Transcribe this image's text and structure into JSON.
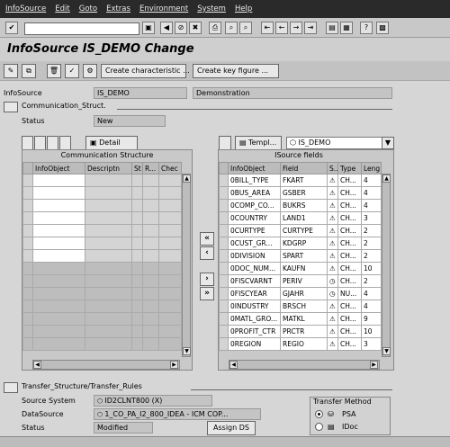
{
  "menu": [
    "InfoSource",
    "Edit",
    "Goto",
    "Extras",
    "Environment",
    "System",
    "Help"
  ],
  "title": "InfoSource IS_DEMO Change",
  "app_toolbar": {
    "create_characteristic": "Create characteristic ...",
    "create_keyfigure": "Create key figure ..."
  },
  "infosource": {
    "label": "InfoSource",
    "value": "IS_DEMO",
    "description": "Demonstration"
  },
  "comm_struct": {
    "section_title": "Communication_Struct.",
    "status_label": "Status",
    "status_value": "New",
    "detail_button": "Detail",
    "panel_title": "Communication Structure",
    "columns": [
      "InfoObject",
      "Descriptn",
      "St",
      "R...",
      "Chec"
    ]
  },
  "isource": {
    "template_button": "Templ...",
    "dropdown_value": "IS_DEMO",
    "panel_title": "ISource fields",
    "columns": [
      "InfoObject",
      "Field",
      "S...",
      "Type",
      "Leng"
    ],
    "rows": [
      [
        "0BILL_TYPE",
        "FKART",
        "CH...",
        "4"
      ],
      [
        "0BUS_AREA",
        "GSBER",
        "CH...",
        "4"
      ],
      [
        "0COMP_CO...",
        "BUKRS",
        "CH...",
        "4"
      ],
      [
        "0COUNTRY",
        "LAND1",
        "CH...",
        "3"
      ],
      [
        "0CURTYPE",
        "CURTYPE",
        "CH...",
        "2"
      ],
      [
        "0CUST_GR...",
        "KDGRP",
        "CH...",
        "2"
      ],
      [
        "0DIVISION",
        "SPART",
        "CH...",
        "2"
      ],
      [
        "0DOC_NUM...",
        "KAUFN",
        "CH...",
        "10"
      ],
      [
        "0FISCVARNT",
        "PERIV",
        "CH...",
        "2"
      ],
      [
        "0FISCYEAR",
        "GJAHR",
        "NU...",
        "4"
      ],
      [
        "0INDUSTRY",
        "BRSCH",
        "CH...",
        "4"
      ],
      [
        "0MATL_GRO...",
        "MATKL",
        "CH...",
        "9"
      ],
      [
        "0PROFIT_CTR",
        "PRCTR",
        "CH...",
        "10"
      ],
      [
        "0REGION",
        "REGIO",
        "CH...",
        "3"
      ]
    ]
  },
  "transfer": {
    "section_title": "Transfer_Structure/Transfer_Rules",
    "source_system_label": "Source System",
    "source_system_value": "ID2CLNT800 (X)",
    "datasource_label": "DataSource",
    "datasource_value": "1_CO_PA_I2_800_IDEA - ICM COP...",
    "status_label": "Status",
    "status_value": "Modified",
    "assign_button": "Assign DS",
    "method_title": "Transfer Method",
    "psa_label": "PSA",
    "idoc_label": "IDoc"
  },
  "icons": [
    "enter-icon",
    "save-icon",
    "back-icon",
    "exit-icon",
    "cancel-icon",
    "print-icon",
    "find-icon",
    "help-icon",
    "layout-icon"
  ]
}
